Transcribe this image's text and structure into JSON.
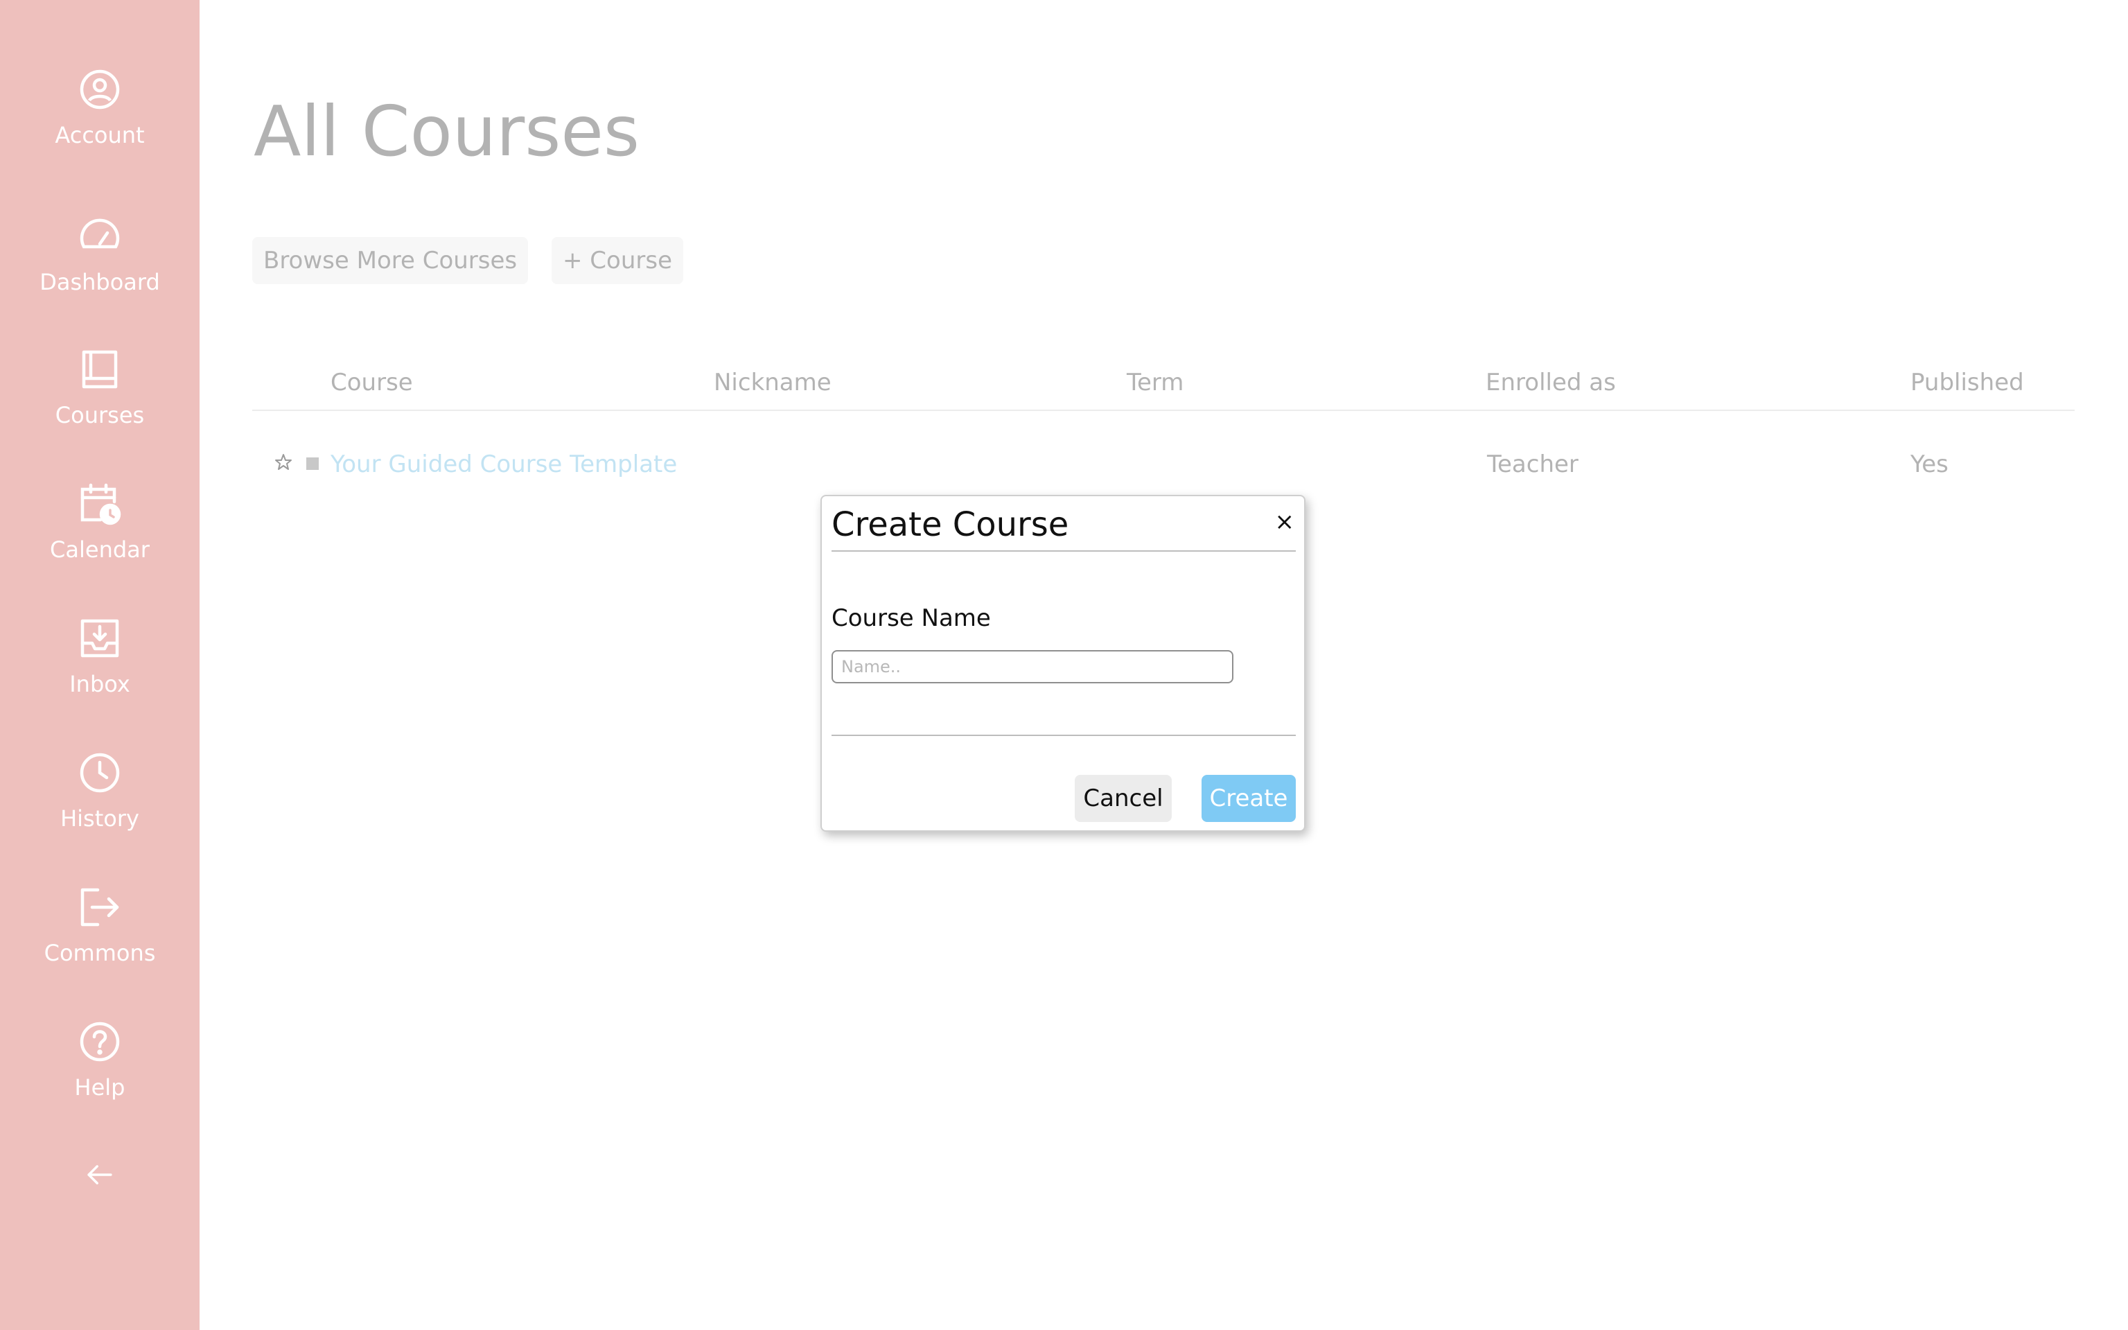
{
  "sidebar": {
    "items": [
      {
        "label": "Account",
        "icon": "account-icon"
      },
      {
        "label": "Dashboard",
        "icon": "dashboard-icon"
      },
      {
        "label": "Courses",
        "icon": "courses-icon"
      },
      {
        "label": "Calendar",
        "icon": "calendar-icon"
      },
      {
        "label": "Inbox",
        "icon": "inbox-icon"
      },
      {
        "label": "History",
        "icon": "history-icon"
      },
      {
        "label": "Commons",
        "icon": "commons-icon"
      },
      {
        "label": "Help",
        "icon": "help-icon"
      }
    ],
    "collapse_icon": "arrow-left-icon",
    "bg_color": "#eec0bd"
  },
  "page": {
    "title": "All Courses",
    "browse_button": "Browse More Courses",
    "add_course_button": "+ Course"
  },
  "table": {
    "headers": {
      "course": "Course",
      "nickname": "Nickname",
      "term": "Term",
      "enrolled_as": "Enrolled as",
      "published": "Published"
    },
    "rows": [
      {
        "course": "Your Guided Course Template",
        "nickname": "",
        "term": "",
        "enrolled_as": "Teacher",
        "published": "Yes"
      }
    ]
  },
  "modal": {
    "title": "Create Course",
    "close_glyph": "×",
    "field_label": "Course Name",
    "input_placeholder": "Name..",
    "input_value": "",
    "cancel_label": "Cancel",
    "create_label": "Create",
    "create_color": "#7fcaf4"
  }
}
